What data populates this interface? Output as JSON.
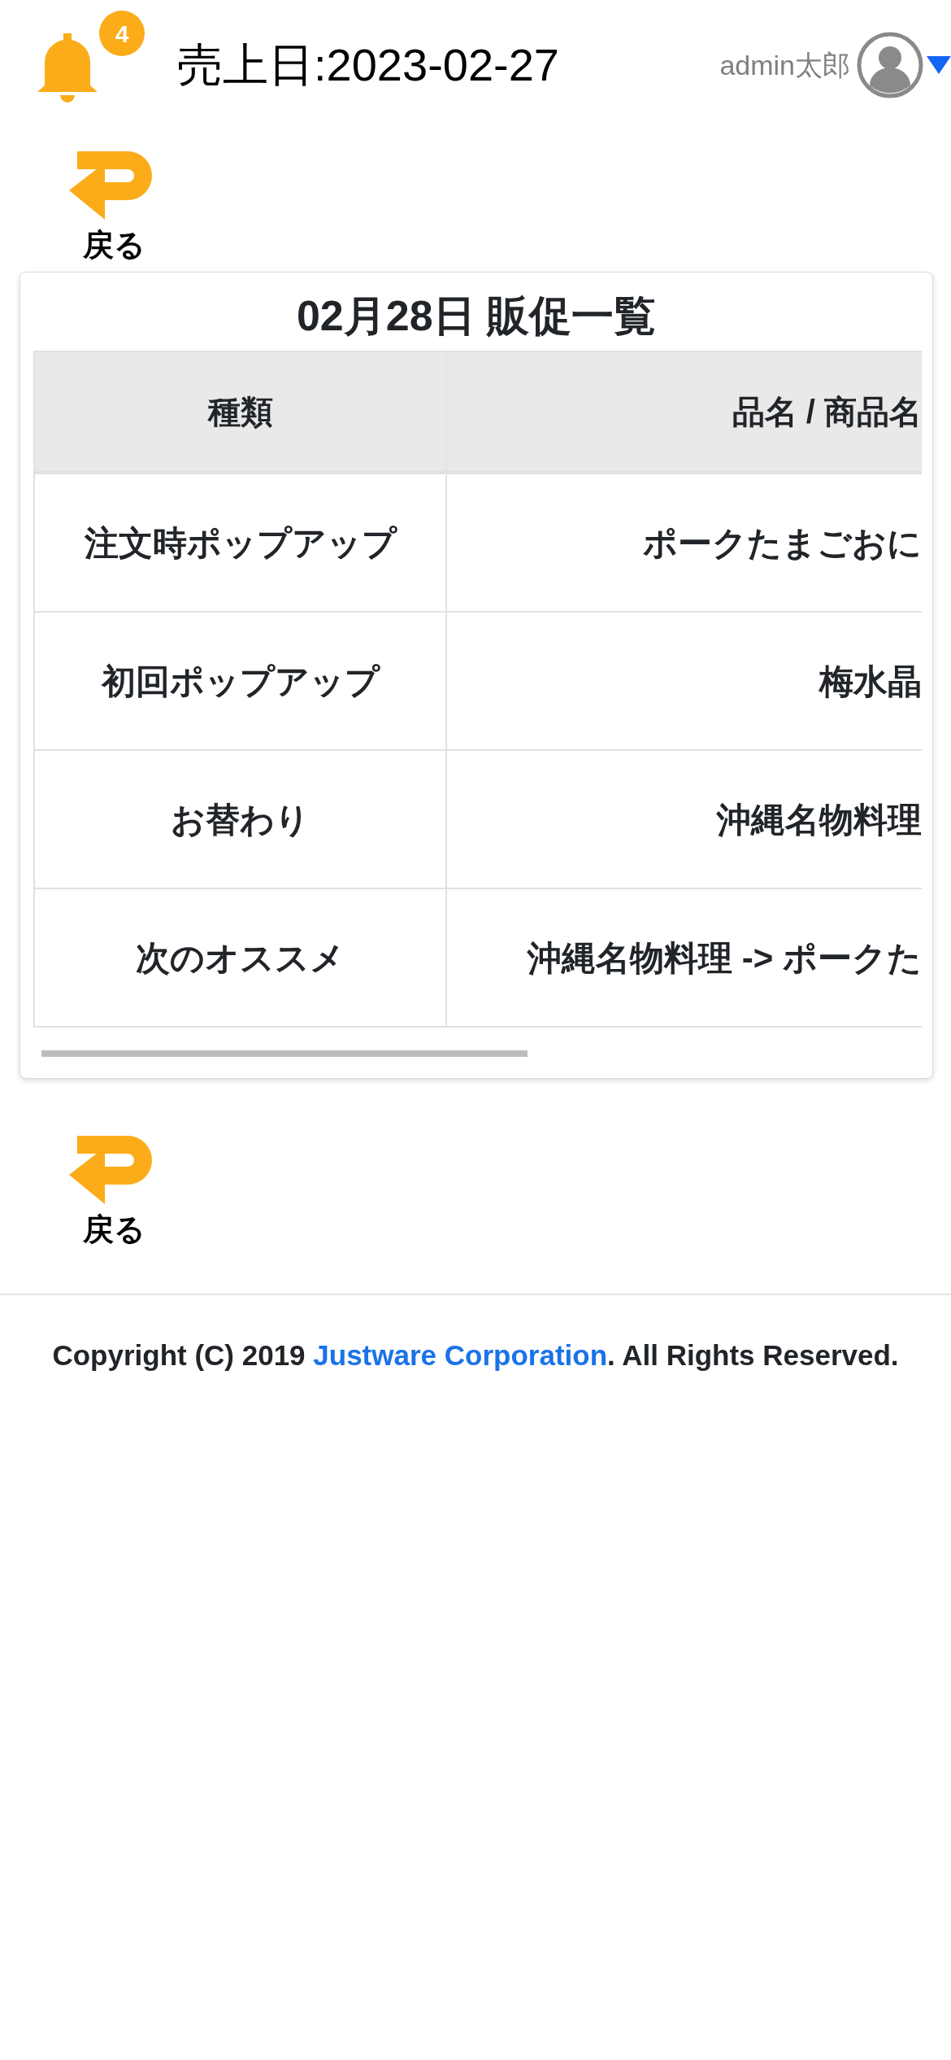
{
  "header": {
    "notification_count": "4",
    "sales_date": "売上日:2023-02-27",
    "user_name": "admin太郎"
  },
  "back_buttons": [
    {
      "label": "戻る"
    },
    {
      "label": "戻る"
    }
  ],
  "card": {
    "title": "02月28日 販促一覧",
    "table": {
      "columns": [
        "種類",
        "品名 / 商品名"
      ],
      "rows": [
        [
          "注文時ポップアップ",
          "ポークたまごおに"
        ],
        [
          "初回ポップアップ",
          "梅水晶"
        ],
        [
          "お替わり",
          "沖縄名物料理"
        ],
        [
          "次のオススメ",
          "沖縄名物料理 -> ポークた"
        ]
      ]
    }
  },
  "footer": {
    "before": "Copyright (C) 2019 ",
    "link": "Justware Corporation",
    "after": ". All Rights Reserved."
  }
}
